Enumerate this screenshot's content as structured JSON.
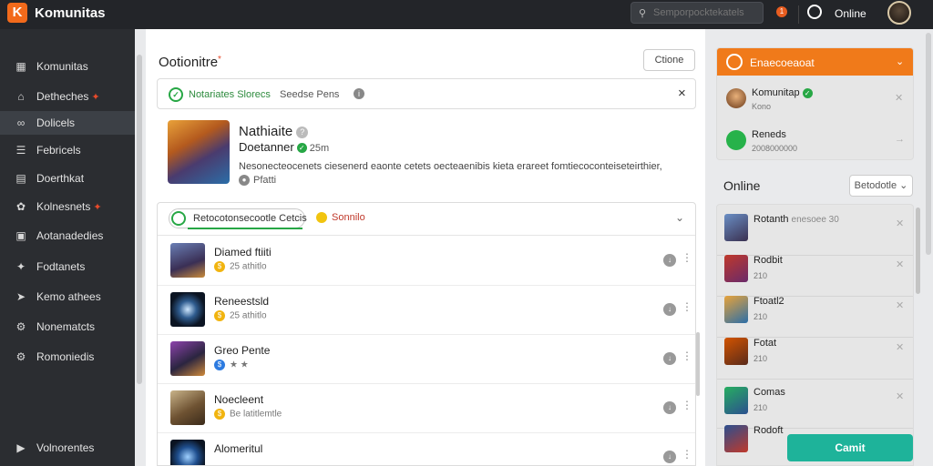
{
  "app": {
    "logo_letter": "K",
    "title": "Komunitas"
  },
  "topbar": {
    "search_placeholder": "Semporpocktekatels",
    "notif_count": "1",
    "status": "Online"
  },
  "sidebar": {
    "items": [
      {
        "label": "Komunitas",
        "badge": ""
      },
      {
        "label": "Detheches",
        "badge": "✦"
      },
      {
        "label": "Dolicels",
        "badge": ""
      },
      {
        "label": "Febricels",
        "badge": ""
      },
      {
        "label": "Doerthkat",
        "badge": ""
      },
      {
        "label": "Kolnesnets",
        "badge": "✦"
      },
      {
        "label": "Aotanadedies",
        "badge": ""
      },
      {
        "label": "Fodtanets",
        "badge": ""
      },
      {
        "label": "Kemo athees",
        "badge": ""
      },
      {
        "label": "Nonematcts",
        "badge": ""
      },
      {
        "label": "Romoniedis",
        "badge": ""
      }
    ],
    "footer": "Volnorentes"
  },
  "main": {
    "title": "Ootionitre",
    "choose_label": "Ctione",
    "alert": {
      "primary": "Notariates Slorecs",
      "secondary": "Seedse Pens",
      "close": "×"
    },
    "game": {
      "name": "Nathiaite",
      "developer": "Doetanner",
      "rating": "25m",
      "description": "Nesonecteocenets ciesenerd eaonte cetets oecteaenibis kieta erareet fomtiecoconteiseteirthier,",
      "meta": "Pfatti"
    },
    "tabs": {
      "active": "Retocotonsecootle Cetcis",
      "second": "Sonnilo"
    },
    "rows": [
      {
        "name": "Diamed ftiiti",
        "sub": "",
        "meta": "25 athitlo",
        "coin": "gold"
      },
      {
        "name": "Reneestsld",
        "sub": "",
        "meta": "25 athitlo",
        "coin": "gold"
      },
      {
        "name": "Greo Pente",
        "sub": "",
        "meta": "★ ★",
        "coin": "blue"
      },
      {
        "name": "Noecleent",
        "sub": "",
        "meta": "Be latitlemtle",
        "coin": "gold"
      },
      {
        "name": "Alomeritul",
        "sub": "",
        "meta": "",
        "coin": "gold"
      }
    ]
  },
  "right": {
    "friends_title": "Enaecoeaoat",
    "friends": [
      {
        "name": "Komunitap",
        "sub": "Kono"
      },
      {
        "name": "Reneds",
        "sub": "2008000000"
      }
    ],
    "online_title": "Online",
    "online_filter": "Betodotle",
    "online": [
      {
        "name": "Rotanth",
        "sub": "enesoee 30",
        "stat": ""
      },
      {
        "name": "Rodbit",
        "sub": "",
        "stat": "210"
      },
      {
        "name": "Ftoatl2",
        "sub": "",
        "stat": "210"
      },
      {
        "name": "Fotat",
        "sub": "",
        "stat": "210"
      },
      {
        "name": "Comas",
        "sub": "",
        "stat": "210"
      },
      {
        "name": "Rodoft",
        "sub": "",
        "stat": ""
      }
    ],
    "submit_label": "Camit"
  }
}
